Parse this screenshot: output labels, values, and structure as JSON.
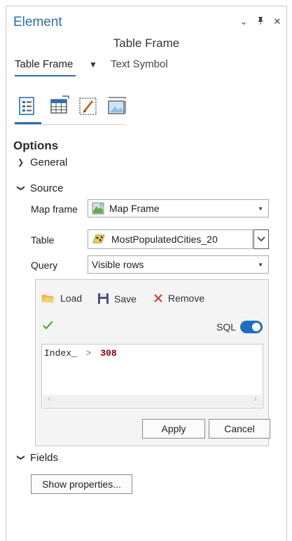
{
  "pane": {
    "title": "Element",
    "subtitle": "Table Frame"
  },
  "tabs": {
    "active": "Table Frame",
    "other": "Text Symbol"
  },
  "options": {
    "heading": "Options",
    "general": "General",
    "source": "Source",
    "fields": "Fields"
  },
  "source": {
    "map_frame_label": "Map frame",
    "map_frame_value": "Map Frame",
    "table_label": "Table",
    "table_value": "MostPopulatedCities_20",
    "query_label": "Query",
    "query_value": "Visible rows"
  },
  "query_builder": {
    "load": "Load",
    "save": "Save",
    "remove": "Remove",
    "sql_label": "SQL",
    "sql_on": true,
    "expr_field": "Index_",
    "expr_op": ">",
    "expr_value": "308",
    "apply": "Apply",
    "cancel": "Cancel"
  },
  "fields": {
    "show_properties": "Show properties..."
  },
  "colors": {
    "accent": "#2a6fb3",
    "toggle": "#1f6fbf",
    "valid_check": "#4b9e2c",
    "remove_x": "#d33b2c",
    "sql_value": "#8b0000"
  }
}
